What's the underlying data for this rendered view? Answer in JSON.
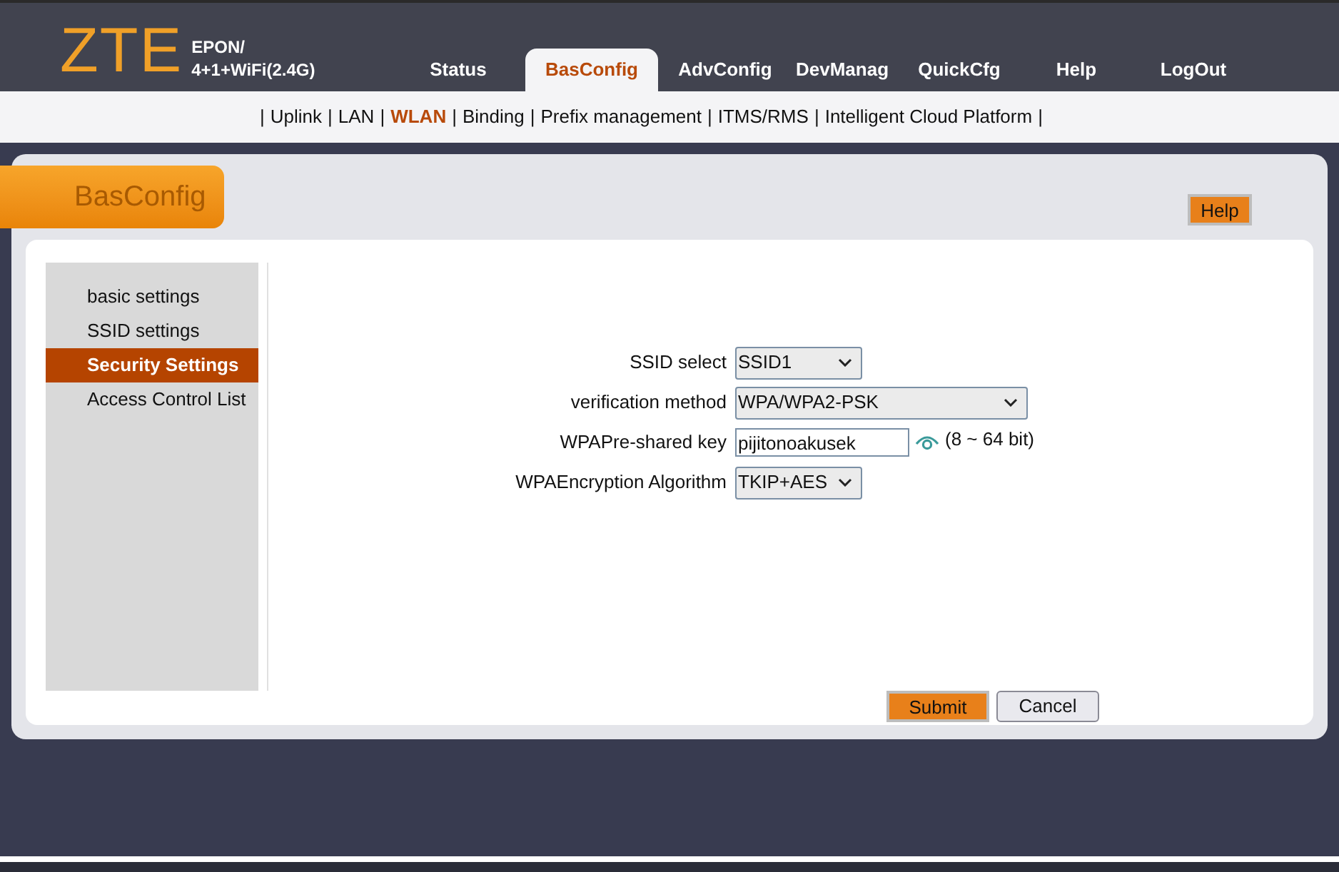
{
  "logo": {
    "mark": "ZTE",
    "model_line_1": "EPON/",
    "model_line_2": "4+1+WiFi(2.4G)"
  },
  "tabs": [
    {
      "label": "Status",
      "selected": false
    },
    {
      "label": "BasConfig",
      "selected": true
    },
    {
      "label": "AdvConfig",
      "selected": false
    },
    {
      "label": "DevManag",
      "selected": false
    },
    {
      "label": "QuickCfg",
      "selected": false
    },
    {
      "label": "Help",
      "selected": false
    },
    {
      "label": "LogOut",
      "selected": false
    }
  ],
  "subnav": {
    "separator": "|",
    "items": [
      {
        "label": "Uplink",
        "selected": false
      },
      {
        "label": "LAN",
        "selected": false
      },
      {
        "label": "WLAN",
        "selected": true
      },
      {
        "label": "Binding",
        "selected": false
      },
      {
        "label": "Prefix management",
        "selected": false
      },
      {
        "label": "ITMS/RMS",
        "selected": false
      },
      {
        "label": "Intelligent Cloud Platform",
        "selected": false
      }
    ]
  },
  "panel": {
    "title": "BasConfig",
    "help_button": "Help"
  },
  "sidebar": {
    "items": [
      {
        "label": "basic settings",
        "selected": false
      },
      {
        "label": "SSID settings",
        "selected": false
      },
      {
        "label": "Security Settings",
        "selected": true
      },
      {
        "label": "Access Control List",
        "selected": false
      }
    ]
  },
  "form": {
    "fields": [
      {
        "kind": "select",
        "label": "SSID select",
        "value": "SSID1",
        "wide": false
      },
      {
        "kind": "select",
        "label": "verification method",
        "value": "WPA/WPA2-PSK",
        "wide": true
      },
      {
        "kind": "password",
        "label": "WPAPre-shared key",
        "value": "pijitonoakusek",
        "hint": "(8 ~ 64 bit)"
      },
      {
        "kind": "select",
        "label": "WPAEncryption Algorithm",
        "value": "TKIP+AES",
        "wide": false
      }
    ]
  },
  "buttons": {
    "submit": "Submit",
    "cancel": "Cancel"
  }
}
